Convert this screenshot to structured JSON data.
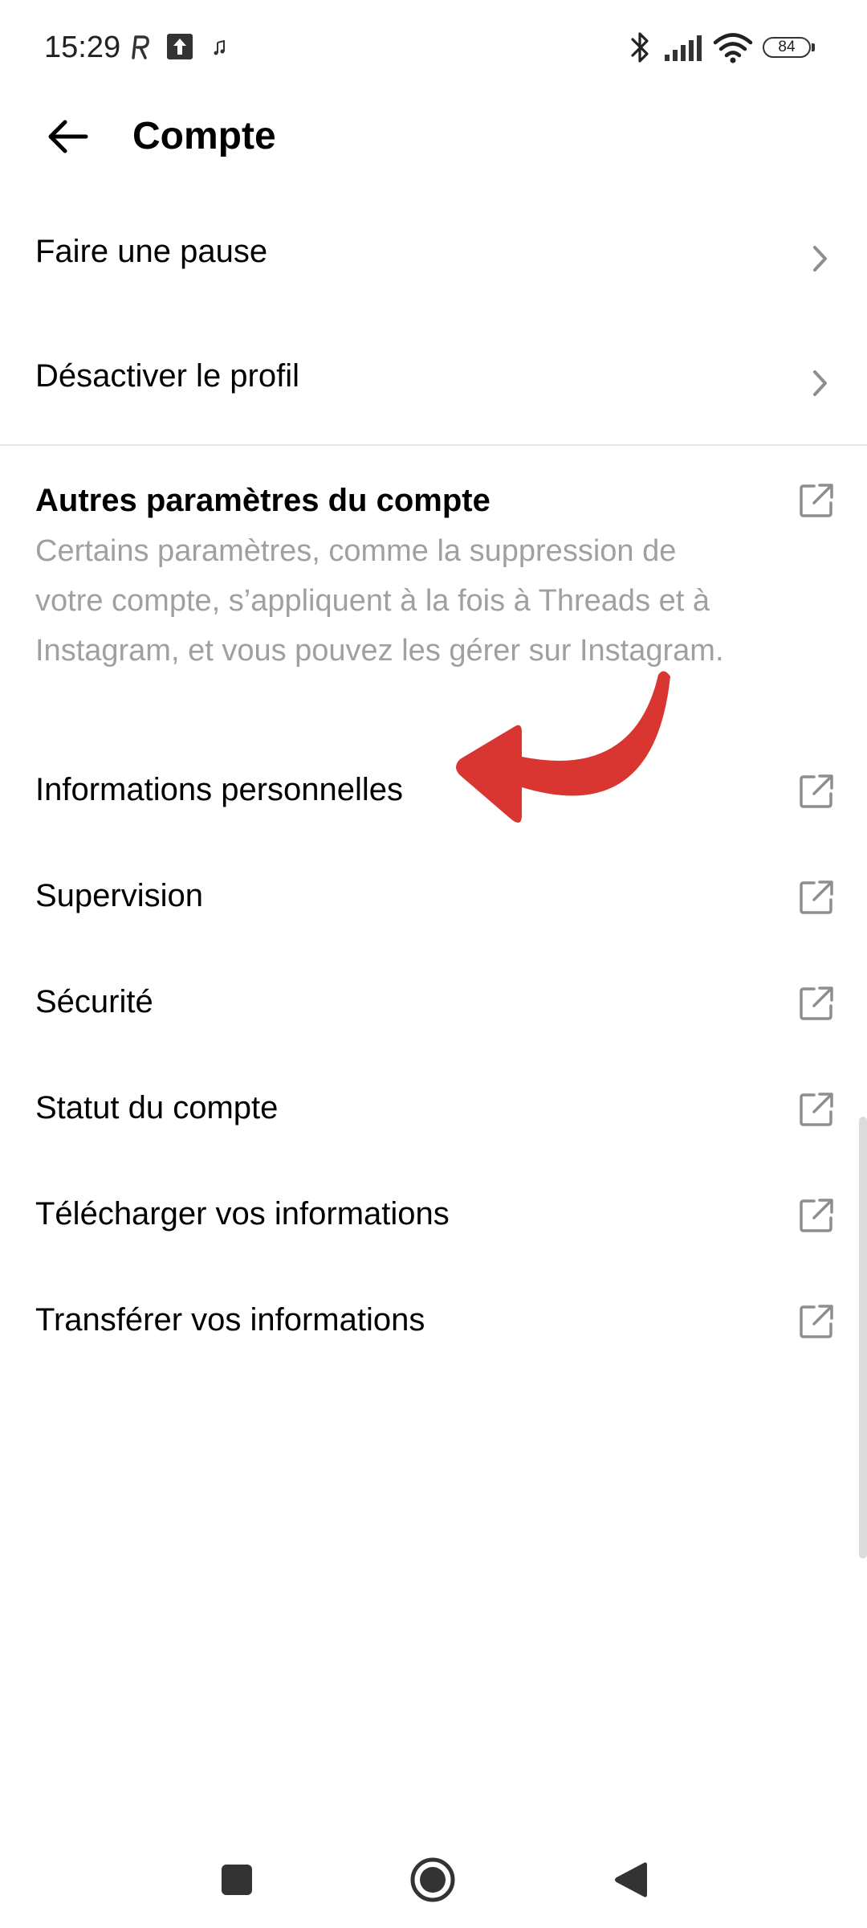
{
  "status_bar": {
    "time": "15:29",
    "left_icons": [
      "r-app-icon",
      "upload-icon",
      "music-note-icon"
    ],
    "right_icons": [
      "bluetooth-icon",
      "signal-icon",
      "wifi-icon",
      "battery-icon"
    ],
    "battery_level": "84"
  },
  "header": {
    "title": "Compte"
  },
  "rows_top": [
    {
      "label": "Faire une pause"
    },
    {
      "label": "Désactiver le profil"
    }
  ],
  "other_settings": {
    "title": "Autres paramètres du compte",
    "description": "Certains paramètres, comme la suppression de votre compte, s’appliquent à la fois à Threads et à Instagram, et vous pouvez les gérer sur Instagram."
  },
  "rows_external": [
    {
      "label": "Informations personnelles"
    },
    {
      "label": "Supervision"
    },
    {
      "label": "Sécurité"
    },
    {
      "label": "Statut du compte"
    },
    {
      "label": "Télécharger vos informations"
    },
    {
      "label": "Transférer vos informations"
    }
  ],
  "colors": {
    "accent_arrow": "#d93632",
    "secondary_text": "#a0a0a0",
    "icon_gray": "#8e8e8e"
  },
  "nav_bar": {
    "buttons": [
      "recent-apps-button",
      "home-button",
      "back-nav-button"
    ]
  }
}
